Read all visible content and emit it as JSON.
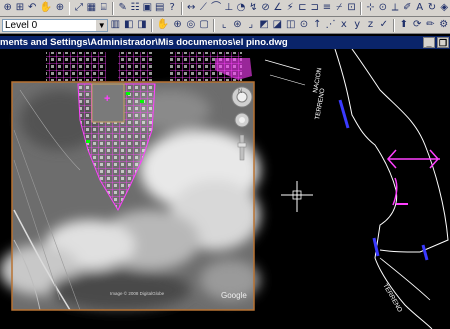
{
  "toolbar_top": {
    "icons": [
      "zoom-realtime-icon",
      "zoom-window-icon",
      "zoom-previous-icon",
      "pan-icon",
      "zoom-icon",
      "zoom-extents-icon",
      "aerial-view-icon",
      "dbconnect-icon",
      "markup-icon",
      "properties-icon",
      "design-center-icon",
      "tool-palettes-icon",
      "help-icon",
      "dim-linear-icon",
      "dim-aligned-icon",
      "dim-arc-icon",
      "dim-ordinate-icon",
      "dim-radius-icon",
      "dim-jogged-icon",
      "dim-diameter-icon",
      "dim-angular-icon",
      "quick-dim-icon",
      "dim-baseline-icon",
      "dim-continue-icon",
      "dim-space-icon",
      "dim-break-icon",
      "tolerance-icon",
      "center-mark-icon",
      "inspect-icon",
      "jogged-linear-icon",
      "dim-edit-icon",
      "dim-text-edit-icon",
      "dim-update-icon",
      "dim-style-icon"
    ]
  },
  "toolbar_bottom": {
    "layer_combo_value": "Level 0",
    "icons": [
      "layer-manager-icon",
      "make-current-icon",
      "layer-previous-icon",
      "pan-icon",
      "zoom-icon",
      "3d-orbit-icon",
      "named-views-icon",
      "ucs-icon",
      "ucs-world-icon",
      "ucs-previous-icon",
      "face-ucs-icon",
      "object-ucs-icon",
      "view-ucs-icon",
      "origin-ucs-icon",
      "zaxis-ucs-icon",
      "3point-ucs-icon",
      "x-ucs-icon",
      "y-ucs-icon",
      "z-ucs-icon",
      "apply-ucs-icon",
      "extrude-icon",
      "revolve-icon",
      "pencil-icon",
      "settings-icon"
    ]
  },
  "document": {
    "title": "ments and Settings\\Administrador\\Mis documentos\\el pino.dwg",
    "buttons": {
      "minimize": "_",
      "restore": "❐"
    }
  },
  "drawing": {
    "labels": {
      "terreno_top": "TERRENO",
      "nacion": "NACION",
      "terreno_bottom": "TERRENO",
      "imagery_credit": "Image © 2008 DigitalGlobe",
      "google": "Google"
    },
    "colors": {
      "background": "#000000",
      "parcel": "#ff40ff",
      "boundary": "#ffffff",
      "road": "#3a3aff",
      "frame": "#b87333",
      "crosshair": "#ffffff"
    }
  }
}
